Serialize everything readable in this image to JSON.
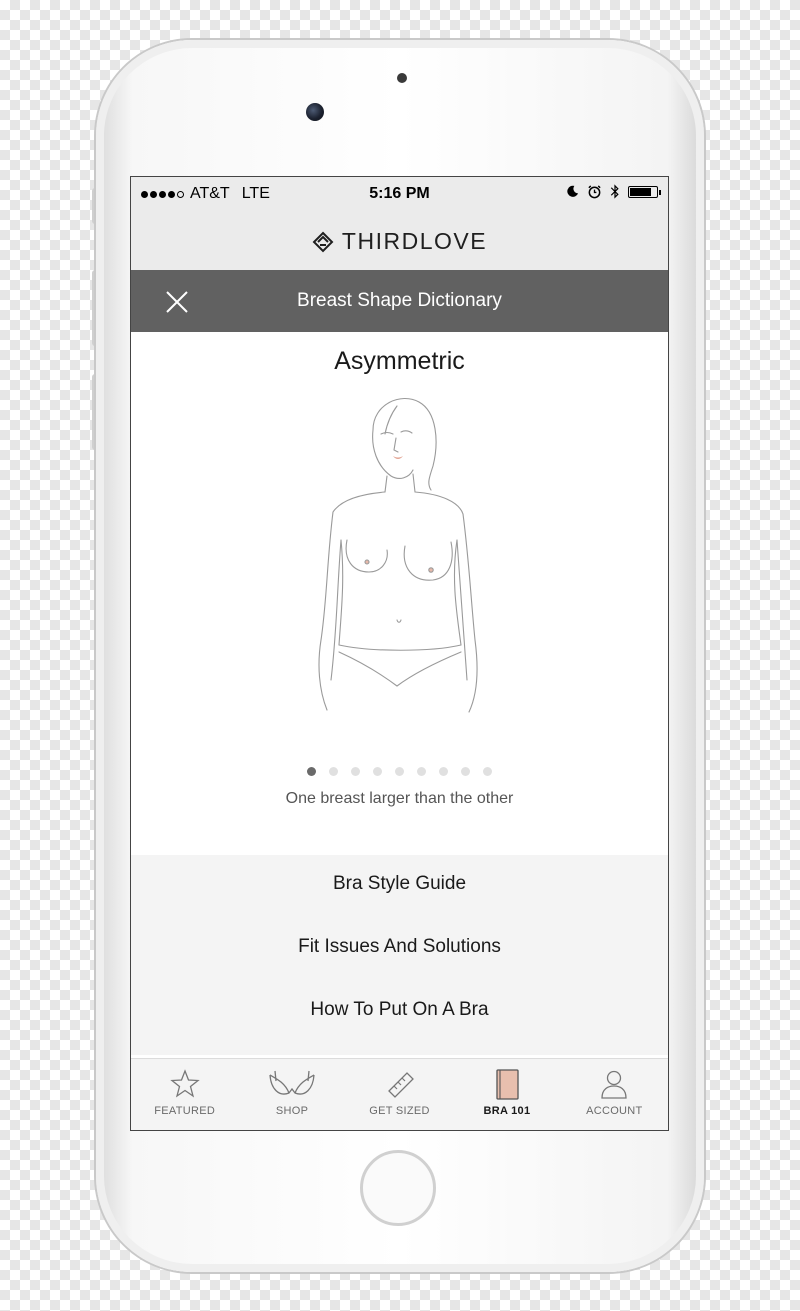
{
  "status_bar": {
    "carrier": "AT&T",
    "network": "LTE",
    "time": "5:16 PM",
    "signal_bars": 4,
    "signal_total": 5,
    "battery_level": 0.8
  },
  "brand": {
    "name": "THIRDLOVE"
  },
  "header": {
    "title": "Breast Shape Dictionary"
  },
  "shape": {
    "title": "Asymmetric",
    "description": "One breast larger than the other",
    "page_index": 1,
    "page_count": 9
  },
  "links": {
    "bra_style_guide": "Bra Style Guide",
    "fit_issues": "Fit Issues And Solutions",
    "how_to_put_on": "How To Put On A Bra"
  },
  "tabs": {
    "featured": "FEATURED",
    "shop": "SHOP",
    "get_sized": "GET SIZED",
    "bra101": "BRA 101",
    "account": "ACCOUNT",
    "active": "BRA 101"
  },
  "colors": {
    "header_bg": "#616161",
    "top_bar_bg": "#ebebeb",
    "active_tab_icon": "#e8bfae"
  }
}
